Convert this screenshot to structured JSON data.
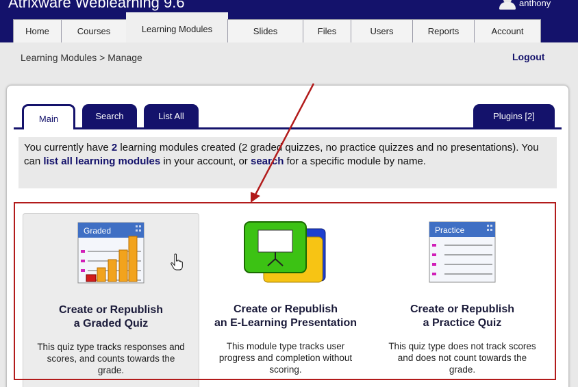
{
  "app": {
    "title": "Atrixware Weblearning 9.6",
    "user": "anthony"
  },
  "nav_tabs": [
    {
      "label": "Home"
    },
    {
      "label": "Courses"
    },
    {
      "label": "Learning Modules"
    },
    {
      "label": "Slides"
    },
    {
      "label": "Files"
    },
    {
      "label": "Users"
    },
    {
      "label": "Reports"
    },
    {
      "label": "Account"
    }
  ],
  "breadcrumb": "Learning Modules > Manage",
  "logout_label": "Logout",
  "sub_tabs": [
    {
      "label": "Main"
    },
    {
      "label": "Search"
    },
    {
      "label": "List All"
    },
    {
      "label": "Plugins [2]"
    }
  ],
  "info": {
    "pre": "You currently have",
    "count": "2",
    "mid": "learning modules created (2 graded quizzes, no practice quizzes and no presentations). You can",
    "link_list": "list all learning modules",
    "mid2": "in your account, or",
    "link_search": "search",
    "post": "for a specific module by name."
  },
  "options": [
    {
      "title1": "Create or Republish",
      "title2": "a Graded Quiz",
      "desc": "This quiz type tracks responses and scores, and counts towards the grade.",
      "icon_label": "Graded",
      "icon": "graded-quiz-icon"
    },
    {
      "title1": "Create or Republish",
      "title2": "an E-Learning Presentation",
      "desc": "This module type tracks user progress and completion without scoring.",
      "icon": "presentation-icon"
    },
    {
      "title1": "Create or Republish",
      "title2": "a Practice Quiz",
      "desc": "This quiz type does not track scores and does not count towards the grade.",
      "icon_label": "Practice",
      "icon": "practice-quiz-icon"
    }
  ],
  "colors": {
    "brand_navy": "#14126b",
    "annotation_red": "#b21b1b",
    "panel_bg": "#e9e9e9"
  }
}
